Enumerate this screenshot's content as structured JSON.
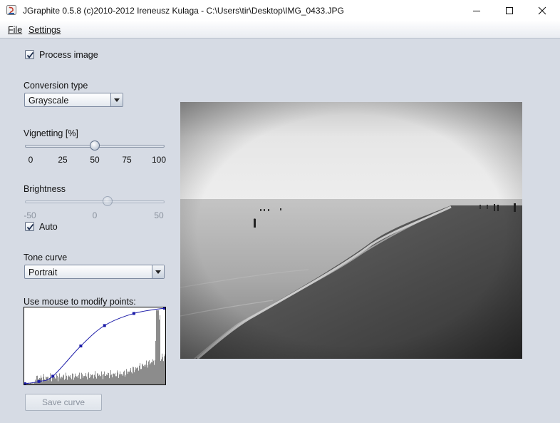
{
  "window": {
    "title": "JGraphite 0.5.8 (c)2010-2012 Ireneusz Kulaga - C:\\Users\\tir\\Desktop\\IMG_0433.JPG",
    "icons": [
      "app-icon",
      "minimize-icon",
      "maximize-icon",
      "close-icon"
    ]
  },
  "menu": {
    "file": "File",
    "settings": "Settings"
  },
  "process_image": {
    "label": "Process image",
    "checked": true
  },
  "conversion": {
    "label": "Conversion type",
    "value": "Grayscale"
  },
  "vignetting": {
    "label": "Vignetting [%]",
    "value": 50,
    "ticks": [
      "0",
      "25",
      "50",
      "75",
      "100"
    ]
  },
  "brightness": {
    "label": "Brightness",
    "value": 10,
    "enabled": false,
    "ticks": [
      "-50",
      "0",
      "50"
    ]
  },
  "auto": {
    "label": "Auto",
    "checked": true
  },
  "tone_curve": {
    "label": "Tone curve",
    "value": "Portrait"
  },
  "curve_editor": {
    "label": "Use mouse to modify points:",
    "points": [
      [
        0,
        0
      ],
      [
        0.1,
        0.03
      ],
      [
        0.2,
        0.1
      ],
      [
        0.4,
        0.5
      ],
      [
        0.57,
        0.77
      ],
      [
        0.78,
        0.93
      ],
      [
        1,
        1
      ]
    ]
  },
  "save_curve": {
    "label": "Save curve",
    "enabled": false
  },
  "preview": {
    "description": "grayscale-beach-photo"
  },
  "colors": {
    "background": "#d6dbe4",
    "curve": "#1c1ca8",
    "histogram": "#8c8c8c"
  }
}
